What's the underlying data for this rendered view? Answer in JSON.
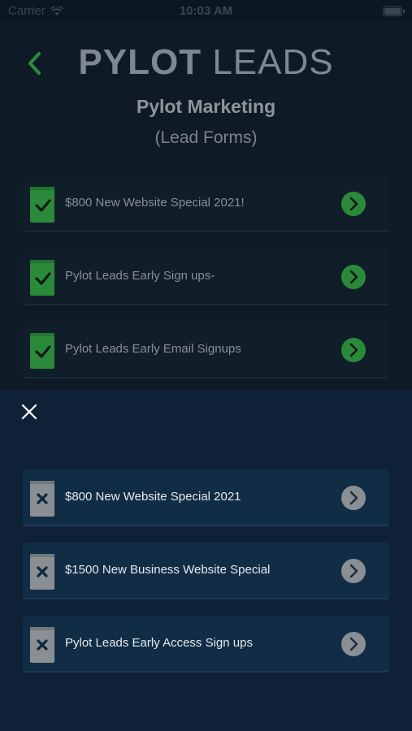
{
  "status_bar": {
    "carrier": "Carrier",
    "time": "10:03 AM"
  },
  "header": {
    "logo_bold": "PYLOT",
    "logo_light": "LEADS",
    "title": "Pylot Marketing",
    "subtitle": "(Lead Forms)"
  },
  "active_forms": [
    {
      "label": "$800 New Website Special 2021!",
      "status": "active"
    },
    {
      "label": "Pylot Leads Early Sign ups-",
      "status": "active"
    },
    {
      "label": "Pylot Leads Early Email Signups",
      "status": "active"
    }
  ],
  "inactive_forms": [
    {
      "label": "$800 New Website Special 2021",
      "status": "inactive"
    },
    {
      "label": "$1500 New Business Website Special",
      "status": "inactive"
    },
    {
      "label": "Pylot Leads Early Access Sign ups",
      "status": "inactive"
    }
  ],
  "icons": {
    "back": "back-chevron-icon",
    "check_doc": "document-check-icon",
    "x_doc": "document-x-icon",
    "arrow": "arrow-right-circle-icon",
    "close": "close-icon",
    "wifi": "wifi-icon",
    "battery": "battery-icon"
  },
  "colors": {
    "accent_green": "#2e8b3f",
    "inactive_gray": "#8a8f94",
    "sheet_background": "#0e2136",
    "card_background": "#112d46"
  }
}
